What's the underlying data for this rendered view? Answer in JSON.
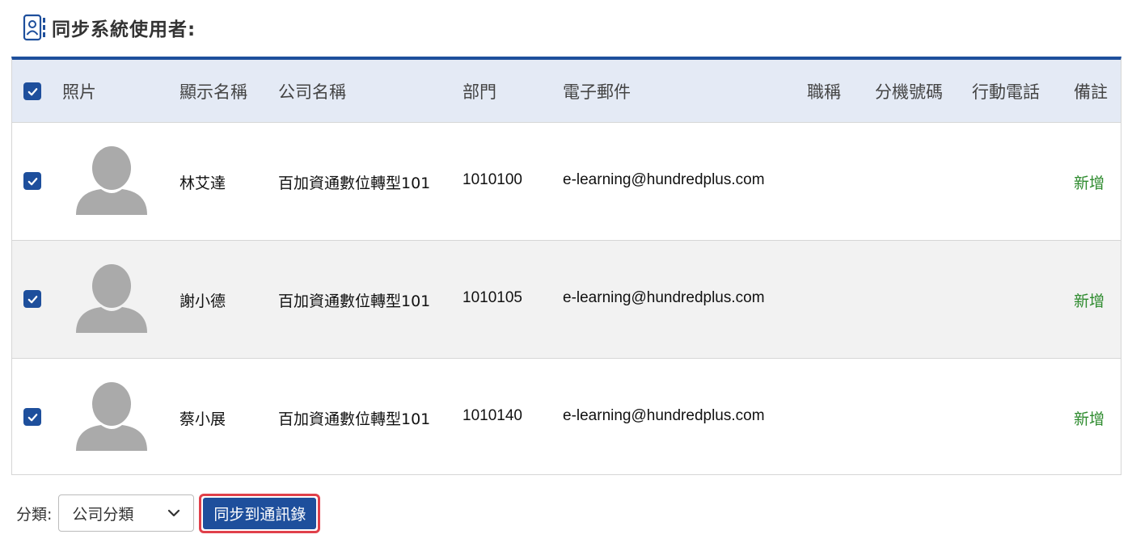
{
  "header": {
    "icon": "contact-book-icon",
    "title": "同步系統使用者:"
  },
  "table": {
    "columns": [
      "照片",
      "顯示名稱",
      "公司名稱",
      "部門",
      "電子郵件",
      "職稱",
      "分機號碼",
      "行動電話",
      "備註"
    ],
    "rows": [
      {
        "checked": true,
        "name": "林艾達",
        "company": "百加資通數位轉型101",
        "dept": "1010100",
        "email": "e-learning@hundredplus.com",
        "title": "",
        "ext": "",
        "mobile": "",
        "note": "新增"
      },
      {
        "checked": true,
        "name": "謝小德",
        "company": "百加資通數位轉型101",
        "dept": "1010105",
        "email": "e-learning@hundredplus.com",
        "title": "",
        "ext": "",
        "mobile": "",
        "note": "新增"
      },
      {
        "checked": true,
        "name": "蔡小展",
        "company": "百加資通數位轉型101",
        "dept": "1010140",
        "email": "e-learning@hundredplus.com",
        "title": "",
        "ext": "",
        "mobile": "",
        "note": "新增"
      }
    ]
  },
  "footer": {
    "category_label": "分類:",
    "category_value": "公司分類",
    "sync_button": "同步到通訊錄"
  },
  "colors": {
    "accent": "#1e4f9c",
    "note_green": "#2e8b2e",
    "highlight_red": "#e0404a",
    "header_bg": "#e4eaf5"
  }
}
